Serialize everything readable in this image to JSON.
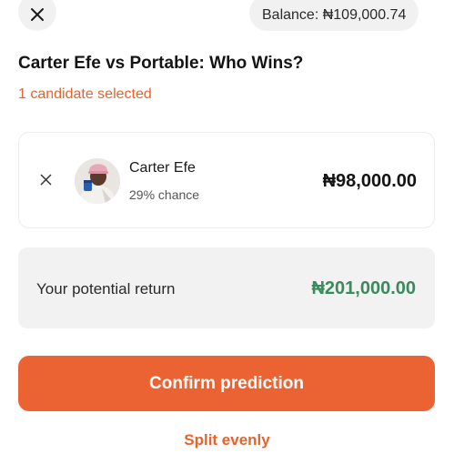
{
  "header": {
    "close_icon": "close-icon",
    "balance_text": "Balance: ₦109,000.74"
  },
  "title": "Carter Efe vs Portable: Who Wins?",
  "selected_count": "1 candidate selected",
  "candidate": {
    "name": "Carter Efe",
    "chance": "29% chance",
    "amount": "₦98,000.00",
    "remove_icon": "close-icon",
    "avatar": "avatar-photo"
  },
  "potential_return": {
    "label": "Your potential return",
    "amount": "₦201,000.00"
  },
  "confirm_label": "Confirm prediction",
  "split_label": "Split evenly",
  "colors": {
    "accent": "#ec6333",
    "accent_text": "#e8622c",
    "positive": "#3a8a5c",
    "surface": "#f2f2f2"
  }
}
